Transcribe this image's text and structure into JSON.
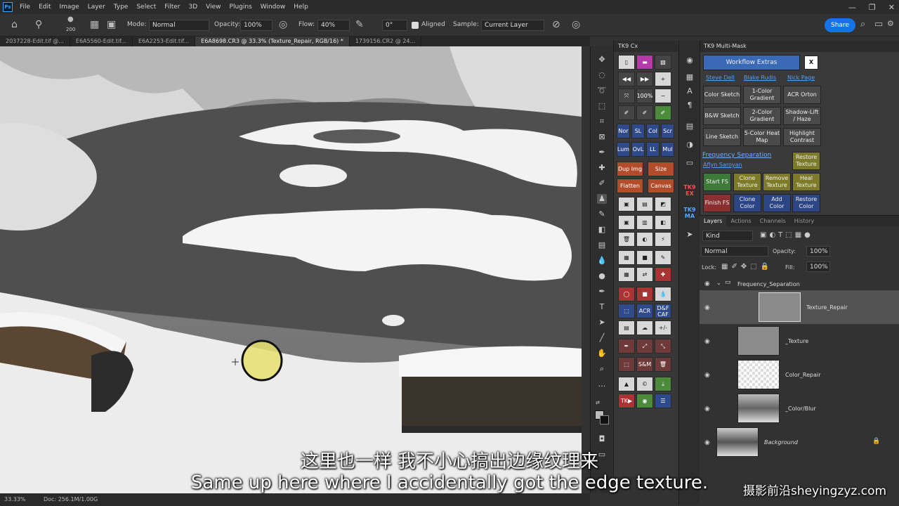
{
  "menu": [
    "File",
    "Edit",
    "Image",
    "Layer",
    "Type",
    "Select",
    "Filter",
    "3D",
    "View",
    "Plugins",
    "Window",
    "Help"
  ],
  "options": {
    "brush_size": "200",
    "mode_label": "Mode:",
    "mode_value": "Normal",
    "opacity_label": "Opacity:",
    "opacity_value": "100%",
    "flow_label": "Flow:",
    "flow_value": "40%",
    "angle_value": "0°",
    "aligned_label": "Aligned",
    "sample_label": "Sample:",
    "sample_value": "Current Layer",
    "share_label": "Share"
  },
  "tabs": [
    "2037228-Edit.tif @...",
    "E6A5560-Edit.tif...",
    "E6A2253-Edit.tif...",
    "E6A8698.CR3 @ 33.3% (Texture_Repair, RGB/16) *",
    "1739156.CR2 @ 24..."
  ],
  "status": {
    "zoom": "33.33%",
    "doc": "Doc: 256.1M/1.00G"
  },
  "tkcx": {
    "title": "TK9 Cx",
    "btn_100": "100%",
    "row_nor": [
      "Nor",
      "SL",
      "Col",
      "Scr"
    ],
    "row_lum": [
      "Lum",
      "OvL",
      "LL",
      "Mul"
    ],
    "dup_img": "Dup Img",
    "size": "Size",
    "flatten": "Flatten",
    "canvas": "Canvas",
    "acr": "ACR",
    "dfcaf": "D&F CAF",
    "sm": "S&M",
    "plusminus": "+/-",
    "tk": "TK▶"
  },
  "strip": {
    "tk9_ex": "TK9 EX",
    "tk9_ma": "TK9 MA"
  },
  "multimask": {
    "title": "TK9 Multi-Mask",
    "workflow": "Workflow Extras",
    "close": "X",
    "links": [
      "Steve Dell",
      "Blake Rudis",
      "Nick Page"
    ],
    "row1": [
      "Color Sketch",
      "1-Color Gradient",
      "ACR Orton"
    ],
    "row2": [
      "B&W Sketch",
      "2-Color Gradient",
      "Shadow-Lift / Haze"
    ],
    "row3": [
      "Line Sketch",
      "5-Color Heat Map",
      "Highlight Contrast"
    ],
    "fs_title": "Frequency Separation",
    "fs_author": "Aflyn Saroyan",
    "restore_texture": "Restore Texture",
    "row_fs1": [
      "Start FS",
      "Clone Texture",
      "Remove Texture",
      "Heal Texture"
    ],
    "row_fs2": [
      "Finish FS",
      "Clone Color",
      "Add Color",
      "Restore Color"
    ]
  },
  "layers": {
    "tabs": [
      "Layers",
      "Actions",
      "Channels",
      "History"
    ],
    "kind": "Kind",
    "blend": "Normal",
    "opacity_label": "Opacity:",
    "opacity_value": "100%",
    "lock_label": "Lock:",
    "fill_label": "Fill:",
    "fill_value": "100%",
    "group": "Frequency_Separation",
    "items": [
      "Texture_Repair",
      "_Texture",
      "Color_Repair",
      "_Color/Blur",
      "Background"
    ]
  },
  "subtitle": {
    "cn": "这里也一样 我不小心搞出边缘纹理来",
    "en": "Same up here where I accidentally got the edge texture."
  },
  "watermark": "摄影前沿sheyingzyz.com"
}
